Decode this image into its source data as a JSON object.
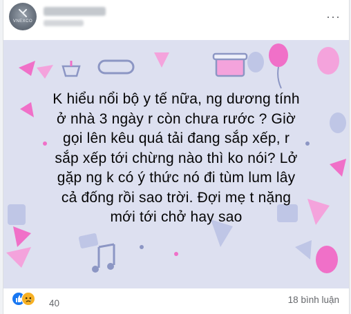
{
  "post": {
    "text": "K hiểu nổi bộ y tế nữa, ng dương tính\nở nhà 3 ngày r còn chưa rước ? Giờ\ngọi lên kêu quá tải đang sắp xếp, r\nsắp xếp tới chừng nào thì ko nói? Lở\ngặp ng k có ý thức nó đi tùm lum lây\ncả đống rồi sao trời. Đợi mẹ t nặng\nmới tới chở hay sao",
    "background_color": "#dde0f0",
    "text_color": "#050505"
  },
  "author": {
    "avatar_icon": "avatar-image",
    "avatar_watermark": "VNEXCO",
    "name_blurred": true
  },
  "menu": {
    "icon": "more-options-icon",
    "label": "···"
  },
  "reactions": {
    "icons": [
      "like-icon",
      "sad-icon"
    ],
    "count": "40"
  },
  "comments": {
    "label": "18 bình luận"
  },
  "colors": {
    "accent": "#1877f2",
    "sad": "#f7b125",
    "pink_decor": "#f070c8",
    "blue_decor": "#a9b3d9"
  }
}
